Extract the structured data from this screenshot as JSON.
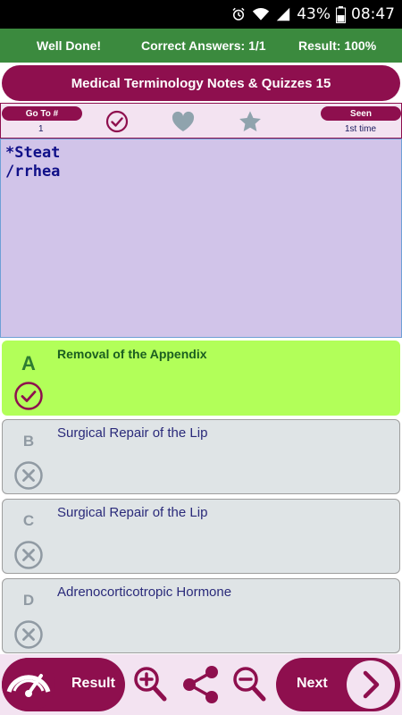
{
  "status_bar": {
    "battery_percent": "43%",
    "time": "08:47"
  },
  "result_strip": {
    "message": "Well Done!",
    "correct_answers": "Correct Answers: 1/1",
    "result": "Result: 100%"
  },
  "title": "Medical Terminology Notes & Quizzes 15",
  "controls": {
    "goto_label": "Go To #",
    "goto_value": "1",
    "seen_label": "Seen",
    "seen_value": "1st time"
  },
  "question": {
    "text": "*Steat\n/rrhea"
  },
  "options": [
    {
      "letter": "A",
      "text": "Removal of the Appendix",
      "state": "correct"
    },
    {
      "letter": "B",
      "text": "Surgical Repair of the Lip",
      "state": "wrong"
    },
    {
      "letter": "C",
      "text": "Surgical Repair of the Lip",
      "state": "wrong"
    },
    {
      "letter": "D",
      "text": "Adrenocorticotropic Hormone",
      "state": "wrong"
    }
  ],
  "bottom_bar": {
    "result_label": "Result",
    "next_label": "Next"
  },
  "colors": {
    "header_green": "#3b8a3e",
    "brand_maroon": "#8e0f4e",
    "question_bg": "#d1c4e9",
    "correct_bg": "#b2ff59",
    "option_bg": "#dfe4e6"
  }
}
